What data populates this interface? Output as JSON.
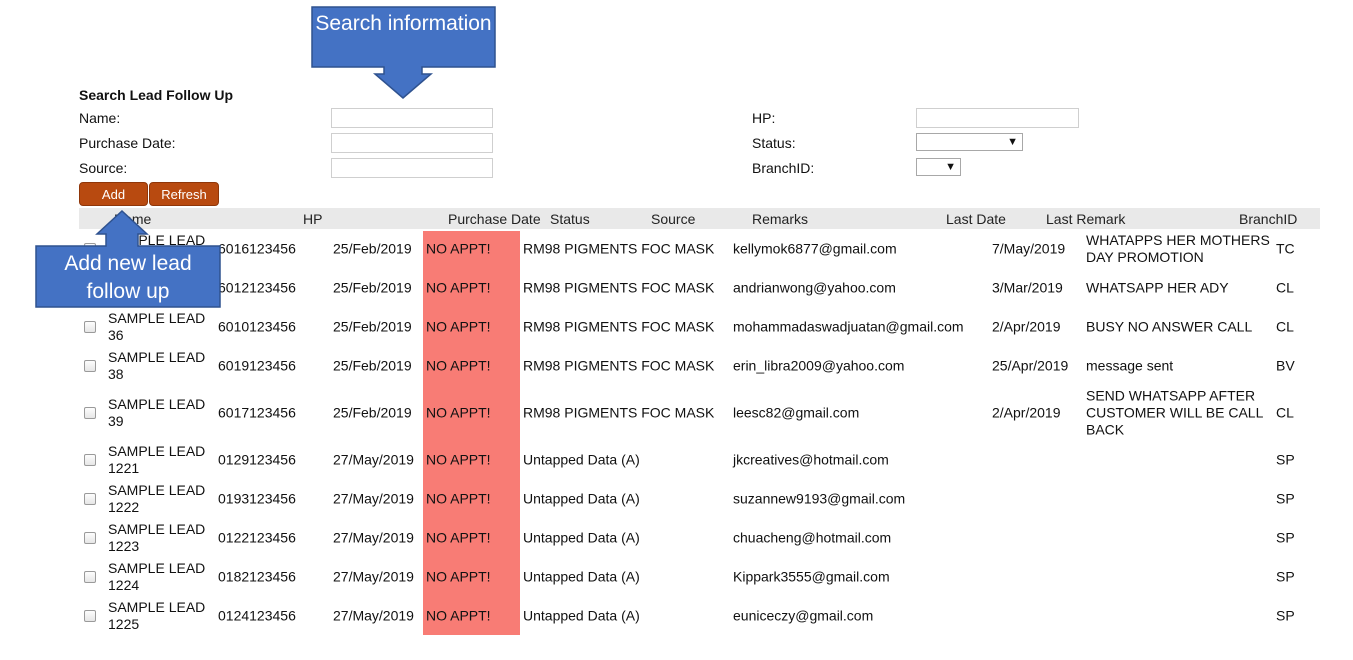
{
  "form": {
    "title": "Search Lead Follow Up",
    "name_label": "Name:",
    "purchase_date_label": "Purchase Date:",
    "source_label": "Source:",
    "hp_label": "HP:",
    "status_label": "Status:",
    "branch_label": "BranchID:",
    "name_value": "",
    "purchase_date_value": "",
    "source_value": "",
    "hp_value": "",
    "status_value": "",
    "branch_value": ""
  },
  "buttons": {
    "add": "Add",
    "refresh": "Refresh"
  },
  "columns": {
    "name": "Name",
    "hp": "HP",
    "purchase_date": "Purchase Date",
    "status": "Status",
    "source": "Source",
    "remarks": "Remarks",
    "last_date": "Last Date",
    "last_remark": "Last Remark",
    "branch": "BranchID"
  },
  "rows": [
    {
      "name": "SAMPLE LEAD",
      "hp": "6016123456",
      "date": "25/Feb/2019",
      "status": "NO APPT!",
      "source": "RM98 PIGMENTS FOC MASK",
      "remarks": "kellymok6877@gmail.com",
      "last_date": "7/May/2019",
      "last_remark": "WHATAPPS HER MOTHERS DAY PROMOTION",
      "branch": "TC"
    },
    {
      "name": "",
      "hp": "6012123456",
      "date": "25/Feb/2019",
      "status": "NO APPT!",
      "source": "RM98 PIGMENTS FOC MASK",
      "remarks": "andrianwong@yahoo.com",
      "last_date": "3/Mar/2019",
      "last_remark": "WHATSAPP HER ADY",
      "branch": "CL"
    },
    {
      "name": "SAMPLE LEAD 36",
      "hp": "6010123456",
      "date": "25/Feb/2019",
      "status": "NO APPT!",
      "source": "RM98 PIGMENTS FOC MASK",
      "remarks": "mohammadaswadjuatan@gmail.com",
      "last_date": "2/Apr/2019",
      "last_remark": "BUSY NO ANSWER CALL",
      "branch": "CL"
    },
    {
      "name": "SAMPLE LEAD 38",
      "hp": "6019123456",
      "date": "25/Feb/2019",
      "status": "NO APPT!",
      "source": "RM98 PIGMENTS FOC MASK",
      "remarks": "erin_libra2009@yahoo.com",
      "last_date": "25/Apr/2019",
      "last_remark": "message sent",
      "branch": "BV"
    },
    {
      "name": "SAMPLE LEAD 39",
      "hp": "6017123456",
      "date": "25/Feb/2019",
      "status": "NO APPT!",
      "source": "RM98 PIGMENTS FOC MASK",
      "remarks": "leesc82@gmail.com",
      "last_date": "2/Apr/2019",
      "last_remark": "SEND WHATSAPP AFTER CUSTOMER WILL BE CALL BACK",
      "branch": "CL"
    },
    {
      "name": "SAMPLE LEAD 1221",
      "hp": "0129123456",
      "date": "27/May/2019",
      "status": "NO APPT!",
      "source": "Untapped Data (A)",
      "remarks": "jkcreatives@hotmail.com",
      "last_date": "",
      "last_remark": "",
      "branch": "SP"
    },
    {
      "name": "SAMPLE LEAD 1222",
      "hp": "0193123456",
      "date": "27/May/2019",
      "status": "NO APPT!",
      "source": "Untapped Data (A)",
      "remarks": "suzannew9193@gmail.com",
      "last_date": "",
      "last_remark": "",
      "branch": "SP"
    },
    {
      "name": "SAMPLE LEAD 1223",
      "hp": "0122123456",
      "date": "27/May/2019",
      "status": "NO APPT!",
      "source": "Untapped Data (A)",
      "remarks": "chuacheng@hotmail.com",
      "last_date": "",
      "last_remark": "",
      "branch": "SP"
    },
    {
      "name": "SAMPLE LEAD 1224",
      "hp": "0182123456",
      "date": "27/May/2019",
      "status": "NO APPT!",
      "source": "Untapped Data (A)",
      "remarks": "Kippark3555@gmail.com",
      "last_date": "",
      "last_remark": "",
      "branch": "SP"
    },
    {
      "name": "SAMPLE LEAD 1225",
      "hp": "0124123456",
      "date": "27/May/2019",
      "status": "NO APPT!",
      "source": "Untapped Data (A)",
      "remarks": "euniceczy@gmail.com",
      "last_date": "",
      "last_remark": "",
      "branch": "SP"
    }
  ],
  "callouts": {
    "search": "Search information",
    "add": "Add new lead follow up"
  },
  "colors": {
    "button_bg": "#b84a10",
    "no_appt_bg": "#f87c75",
    "callout_bg": "#4472c4",
    "header_bg": "#e9e9e9"
  }
}
